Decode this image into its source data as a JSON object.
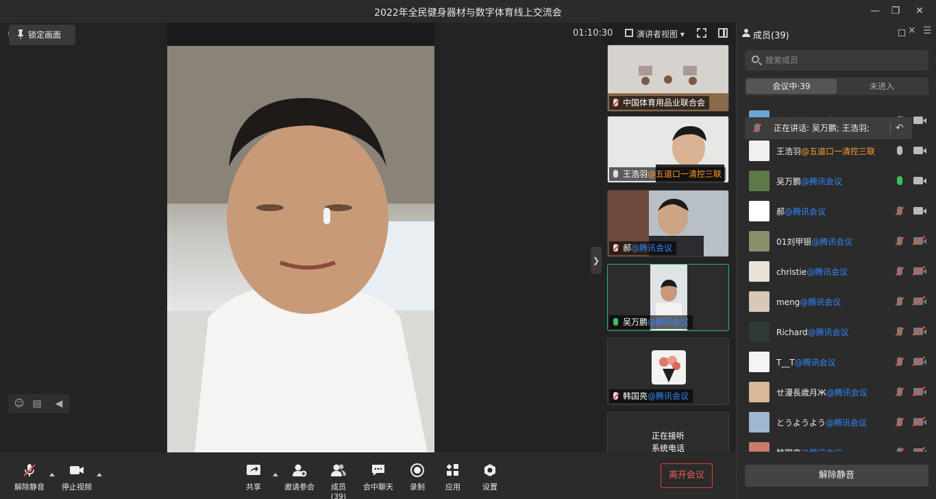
{
  "window": {
    "title": "2022年全民健身器材与数字体育线上交流会",
    "controls": [
      "minimize-icon",
      "restore-icon",
      "close-icon"
    ]
  },
  "stage": {
    "timer": "01:10:30",
    "lock_label": "锁定画面",
    "view_mode": "演讲者视图",
    "info_glyph": "i",
    "shield_glyph": "+"
  },
  "thumbnails": [
    {
      "name": "中国体育用品业联合会",
      "suffix": "",
      "suffix_type": "",
      "mic": "muted"
    },
    {
      "name": "王浩羽",
      "suffix": "@五道口一清控三联",
      "suffix_type": "org",
      "mic": "on"
    },
    {
      "name": "郝",
      "suffix": "@腾讯会议",
      "suffix_type": "tx",
      "mic": "muted"
    },
    {
      "name": "吴万鹏",
      "suffix": "@腾讯会议",
      "suffix_type": "tx",
      "mic": "speaking"
    },
    {
      "name": "韩国亮",
      "suffix": "@腾讯会议",
      "suffix_type": "tx",
      "mic": "muted"
    },
    {
      "name": "正在接听\n系统电话",
      "suffix": "",
      "suffix_type": "",
      "mic": ""
    }
  ],
  "toolbar": {
    "unmute": "解除静音",
    "stop_video": "停止视频",
    "share": "共享",
    "invite": "邀请参会",
    "members": "成员(39)",
    "chat": "会中聊天",
    "record": "录制",
    "apps": "应用",
    "settings": "设置",
    "leave": "离开会议"
  },
  "panel": {
    "title": "成员(39)",
    "search_placeholder": "搜索成员",
    "tab_in": "会议中·39",
    "tab_out": "未进入",
    "speaking_tip": "正在讲话: 吴万鹏; 王浩羽;",
    "unmute_all": "解除静音",
    "members": [
      {
        "name": "中国体育用品业联合会",
        "suffix": "",
        "suffix_type": "",
        "mic": "muted",
        "cam": "on",
        "avatar": "#6aa8d8"
      },
      {
        "name": "王浩羽",
        "suffix": "@五道口一清控三联",
        "suffix_type": "org",
        "mic": "on",
        "cam": "on",
        "avatar": "#f0f0f0"
      },
      {
        "name": "吴万鹏",
        "suffix": "@腾讯会议",
        "suffix_type": "tx",
        "mic": "speaking",
        "cam": "on",
        "avatar": "#5d7a4a"
      },
      {
        "name": "郝",
        "suffix": "@腾讯会议",
        "suffix_type": "tx",
        "mic": "muted",
        "cam": "on",
        "avatar": "#ffffff"
      },
      {
        "name": "01刘甲银",
        "suffix": "@腾讯会议",
        "suffix_type": "tx",
        "mic": "muted",
        "cam": "off",
        "avatar": "#8b8f6a"
      },
      {
        "name": "christie",
        "suffix": "@腾讯会议",
        "suffix_type": "tx",
        "mic": "muted",
        "cam": "off",
        "avatar": "#e8e2d8"
      },
      {
        "name": "meng",
        "suffix": "@腾讯会议",
        "suffix_type": "tx",
        "mic": "muted",
        "cam": "off",
        "avatar": "#d9c7b8"
      },
      {
        "name": "Richard",
        "suffix": "@腾讯会议",
        "suffix_type": "tx",
        "mic": "muted",
        "cam": "off",
        "avatar": "#2e3a34"
      },
      {
        "name": "T__T",
        "suffix": "@腾讯会议",
        "suffix_type": "tx",
        "mic": "muted",
        "cam": "off",
        "avatar": "#f4f4f4"
      },
      {
        "name": "せ漫長歳月Ж",
        "suffix": "@腾讯会议",
        "suffix_type": "tx",
        "mic": "muted",
        "cam": "off",
        "avatar": "#d8b897"
      },
      {
        "name": "とうようよう",
        "suffix": "@腾讯会议",
        "suffix_type": "tx",
        "mic": "muted",
        "cam": "off",
        "avatar": "#9fb8cf"
      },
      {
        "name": "韩国亮",
        "suffix": "@腾讯会议",
        "suffix_type": "tx",
        "mic": "muted",
        "cam": "off",
        "avatar": "#c97a6a"
      }
    ]
  },
  "colors": {
    "speaking": "#3cc05a",
    "tx_suffix": "#2f86ff",
    "org_suffix": "#ff9a2e",
    "leave": "#e0413f"
  }
}
